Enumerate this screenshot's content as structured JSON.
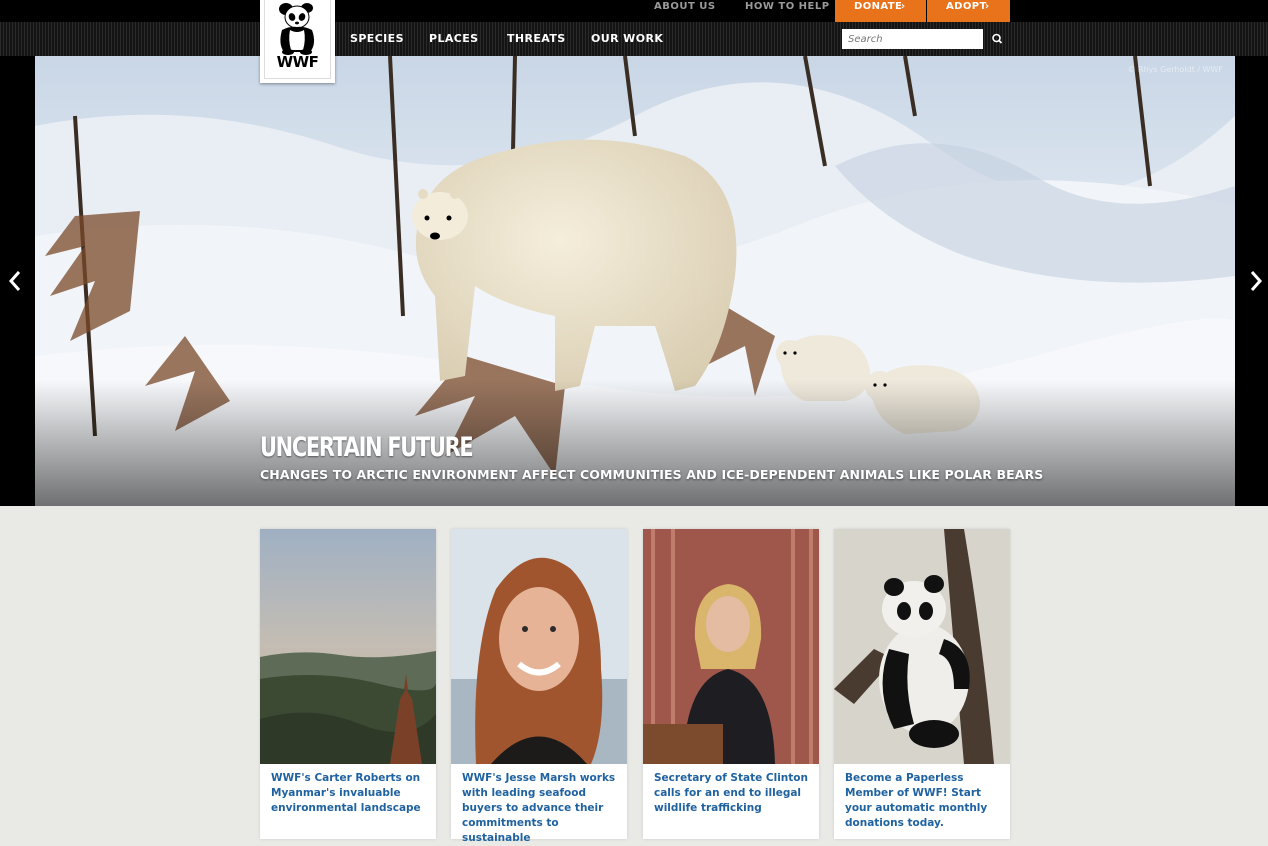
{
  "header": {
    "util_links": [
      "ABOUT US",
      "HOW TO HELP"
    ],
    "donate_label": "DONATE",
    "adopt_label": "ADOPT",
    "nav": [
      "SPECIES",
      "PLACES",
      "THREATS",
      "OUR WORK"
    ],
    "search_placeholder": "Search",
    "logo_text": "WWF"
  },
  "hero": {
    "credit": "© Rhys Gerholdt / WWF",
    "title": "UNCERTAIN FUTURE",
    "subtitle": "CHANGES TO ARCTIC ENVIRONMENT AFFECT COMMUNITIES AND ICE-DEPENDENT ANIMALS LIKE POLAR BEARS"
  },
  "cards": [
    {
      "caption": "WWF's Carter Roberts on Myanmar's invaluable environmental landscape"
    },
    {
      "caption": "WWF's Jesse Marsh works with leading seafood buyers to advance their commitments to sustainable"
    },
    {
      "caption": "Secretary of State Clinton calls for an end to illegal wildlife trafficking"
    },
    {
      "caption": "Become a Paperless Member of WWF! Start your automatic monthly donations today."
    }
  ],
  "colors": {
    "accent": "#e8731b",
    "link": "#1f62a0",
    "topbar": "#000000"
  },
  "icons": [
    "panda-logo-icon",
    "search-icon",
    "chevron-left-icon",
    "chevron-right-icon",
    "chevron-right-small-icon"
  ]
}
